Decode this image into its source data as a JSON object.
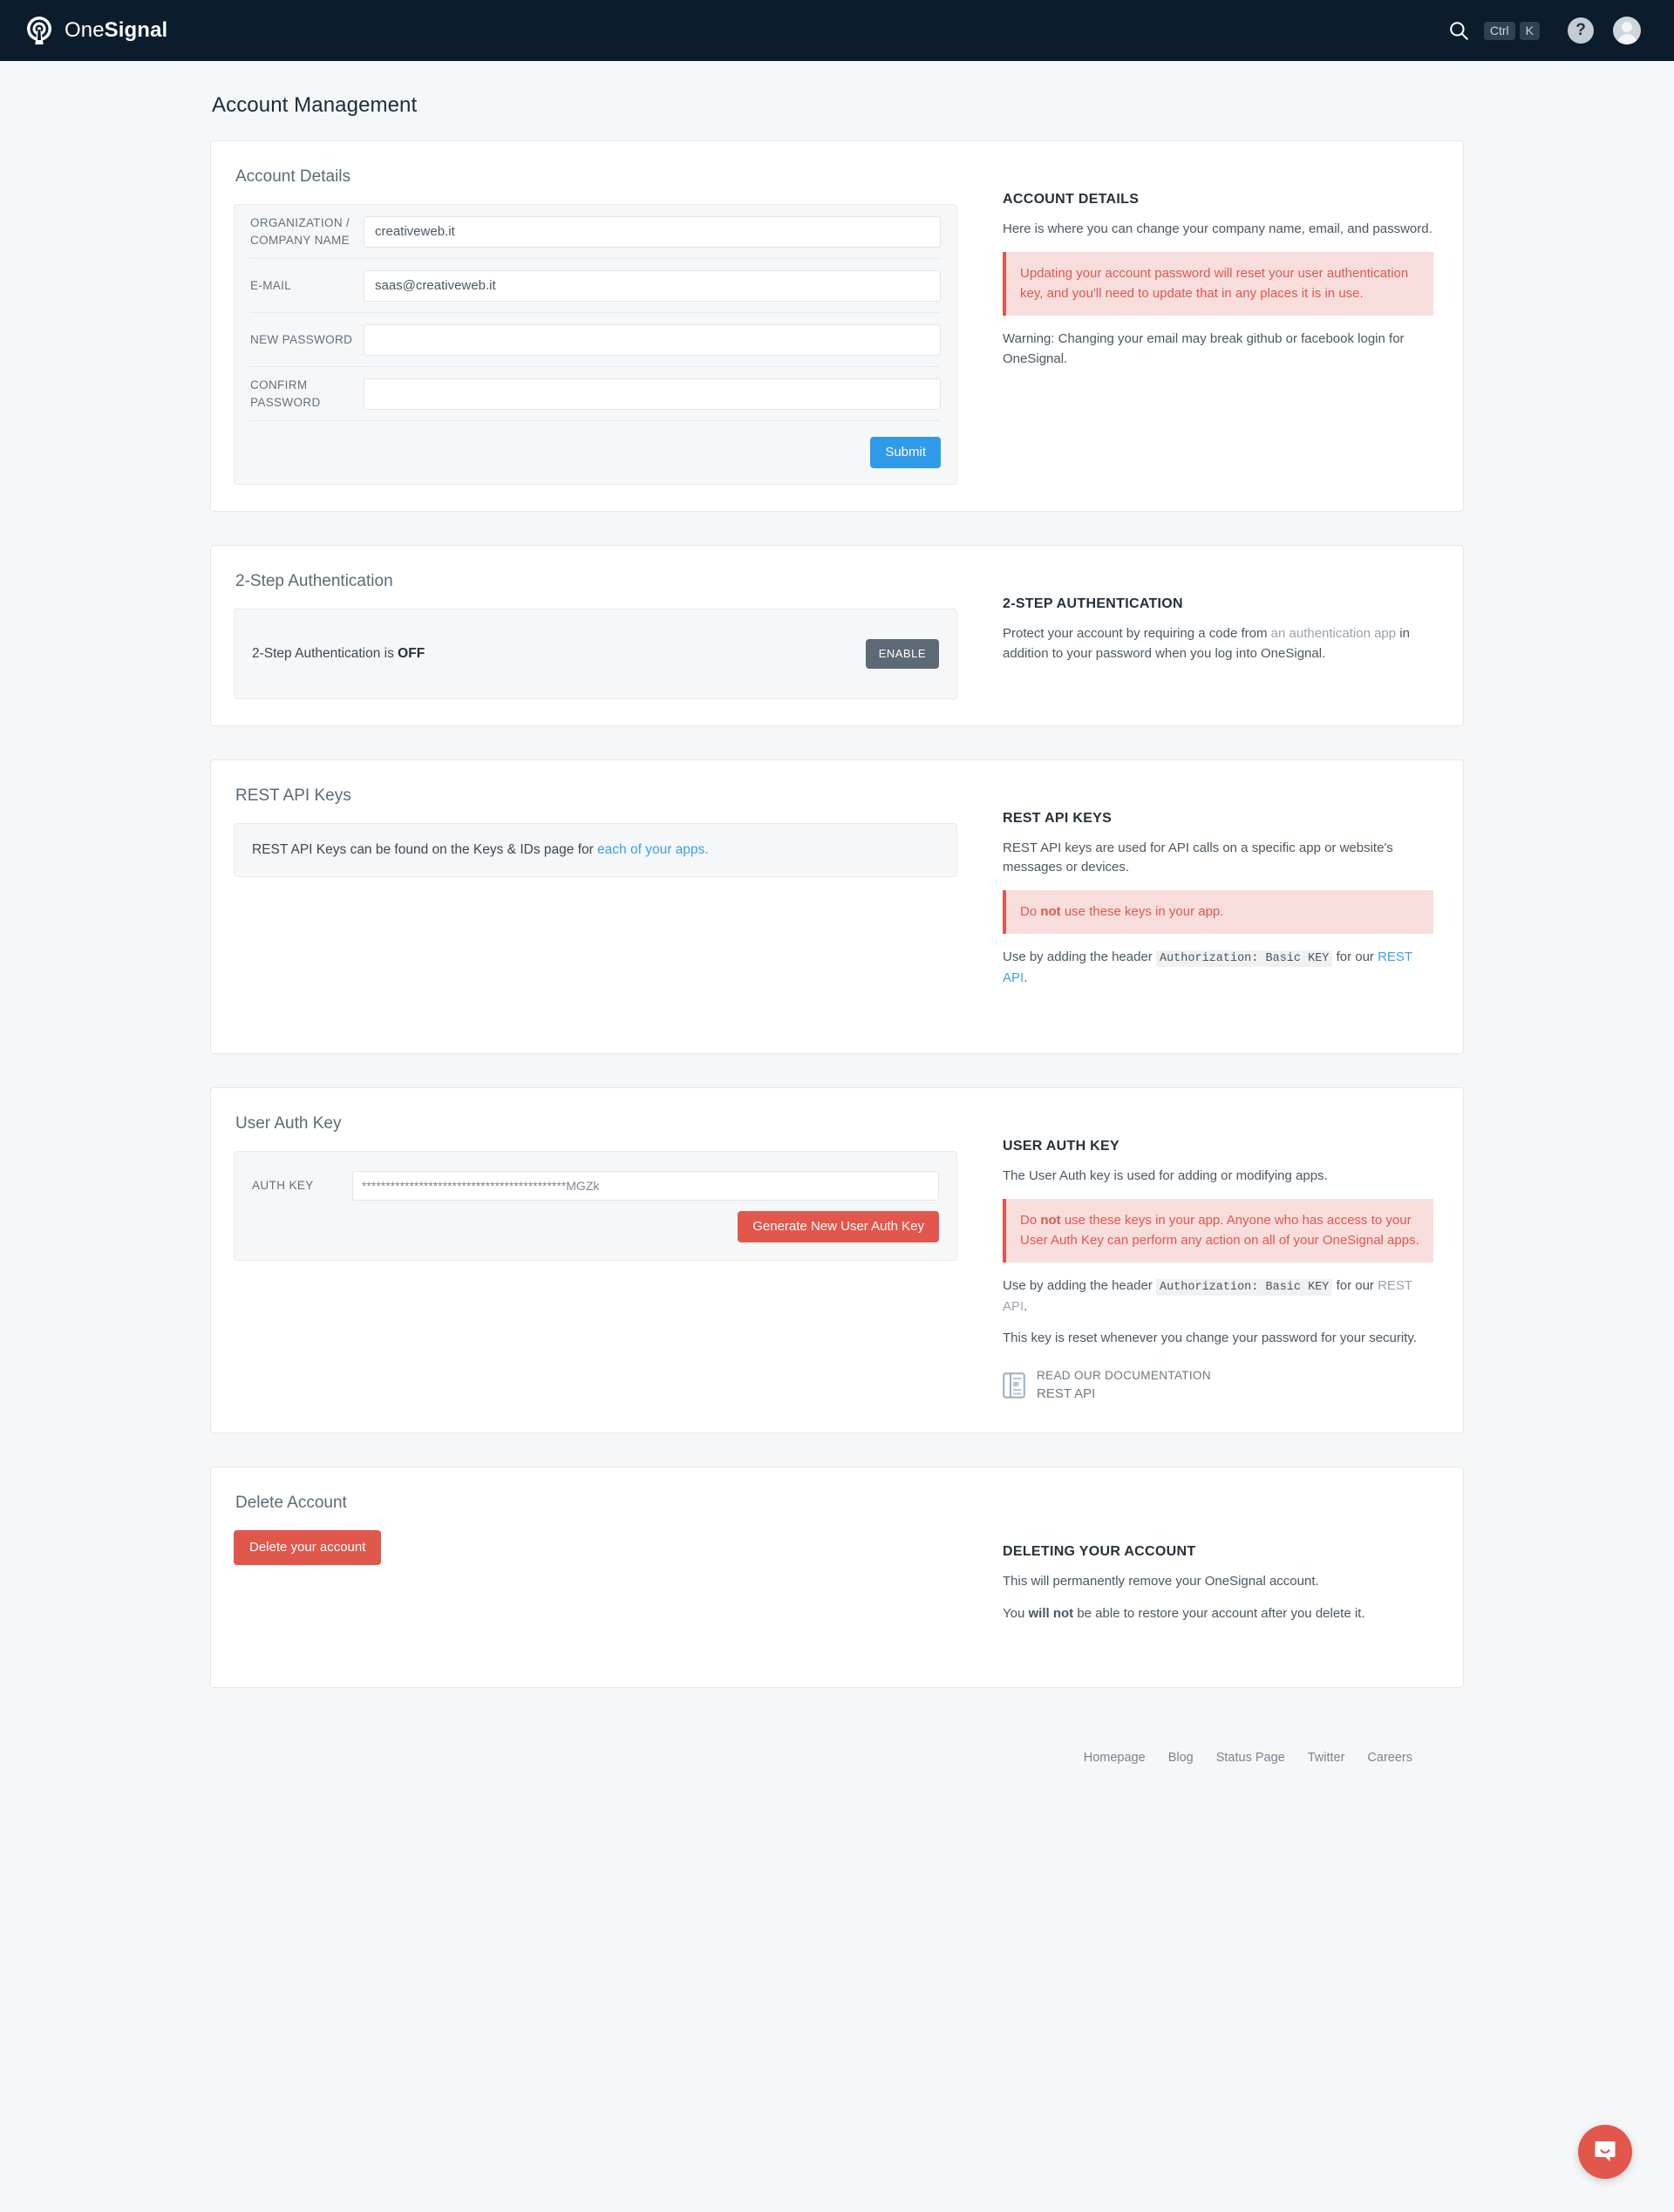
{
  "navbar": {
    "brand_one": "One",
    "brand_signal": "Signal",
    "search_icon": "search-icon",
    "kbd_ctrl": "Ctrl",
    "kbd_k": "K",
    "help_label": "?",
    "avatar_label": "avatar"
  },
  "page": {
    "title": "Account Management"
  },
  "account_details": {
    "card_title": "Account Details",
    "fields": {
      "org_label": "ORGANIZATION / COMPANY NAME",
      "org_value": "creativeweb.it",
      "email_label": "E-MAIL",
      "email_value": "saas@creativeweb.it",
      "new_password_label": "NEW PASSWORD",
      "new_password_value": "",
      "confirm_password_label": "CONFIRM PASSWORD",
      "confirm_password_value": ""
    },
    "submit_label": "Submit",
    "info_head": "ACCOUNT DETAILS",
    "info_p1": "Here is where you can change your company name, email, and password.",
    "alert_text": "Updating your account password will reset your user authentication key, and you'll need to update that in any places it is in use.",
    "info_p2": "Warning: Changing your email may break github or facebook login for OneSignal."
  },
  "two_step": {
    "card_title": "2-Step Authentication",
    "status_prefix": "2-Step Authentication is ",
    "status_value": "OFF",
    "enable_label": "ENABLE",
    "info_head": "2-STEP AUTHENTICATION",
    "info_p_a": "Protect your account by requiring a code from ",
    "info_link": "an authentication app",
    "info_p_b": " in addition to your password when you log into OneSignal."
  },
  "rest_api_keys": {
    "card_title": "REST API Keys",
    "note_text": "REST API Keys can be found on the Keys & IDs page for ",
    "note_link": "each of your apps.",
    "info_head": "REST API KEYS",
    "info_p1": "REST API keys are used for API calls on a specific app or website's messages or devices.",
    "alert_prefix": "Do ",
    "alert_bold": "not",
    "alert_suffix": " use these keys in your app.",
    "header_prefix": "Use by adding the header ",
    "header_code": "Authorization: Basic KEY",
    "header_mid": " for our ",
    "header_link": "REST API",
    "header_suffix": "."
  },
  "user_auth_key": {
    "card_title": "User Auth Key",
    "auth_key_label": "AUTH KEY",
    "auth_key_value": "*******************************************MGZk",
    "generate_label": "Generate New User Auth Key",
    "info_head": "USER AUTH KEY",
    "info_p1": "The User Auth key is used for adding or modifying apps.",
    "alert_prefix": "Do ",
    "alert_bold": "not",
    "alert_suffix": " use these keys in your app. Anyone who has access to your User Auth Key can perform any action on all of your OneSignal apps.",
    "header_prefix": "Use by adding the header ",
    "header_code": "Authorization: Basic KEY",
    "header_mid": " for our ",
    "header_link": "REST API",
    "header_suffix": ".",
    "info_p2": "This key is reset whenever you change your password for your security.",
    "doc_line1": "READ OUR DOCUMENTATION",
    "doc_line2": "REST API"
  },
  "delete_account": {
    "card_title": "Delete Account",
    "delete_label": "Delete your account",
    "info_head": "DELETING YOUR ACCOUNT",
    "info_p1": "This will permanently remove your OneSignal account.",
    "info_p2_prefix": "You ",
    "info_p2_bold": "will not",
    "info_p2_suffix": " be able to restore your account after you delete it."
  },
  "footer": {
    "links": [
      {
        "label": "Homepage"
      },
      {
        "label": "Blog"
      },
      {
        "label": "Status Page"
      },
      {
        "label": "Twitter"
      },
      {
        "label": "Careers"
      }
    ]
  },
  "colors": {
    "navbar_bg": "#0b1c2d",
    "accent_blue": "#2f9ae8",
    "danger_red": "#e2574c",
    "enable_grey": "#5d6a75",
    "page_bg": "#f5f7f8"
  }
}
